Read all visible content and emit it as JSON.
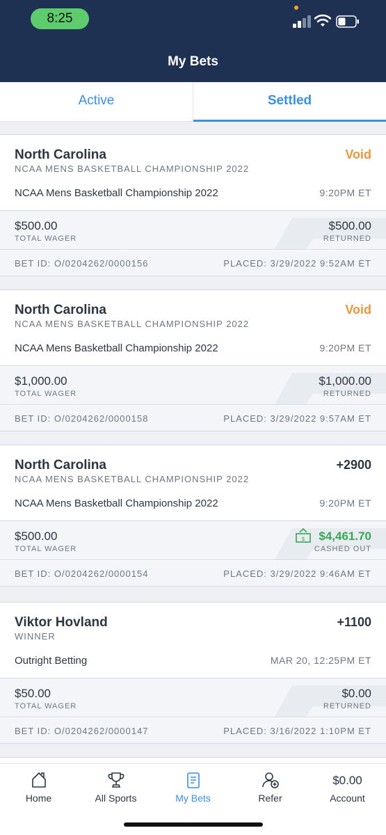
{
  "status_bar": {
    "time": "8:25"
  },
  "header": {
    "title": "My Bets"
  },
  "tabs": [
    {
      "label": "Active"
    },
    {
      "label": "Settled"
    }
  ],
  "bets": [
    {
      "selection": "North Carolina",
      "result": "Void",
      "market": "NCAA MENS BASKETBALL CHAMPIONSHIP 2022",
      "event": "NCAA Mens Basketball Championship 2022",
      "time": "9:20PM ET",
      "wager": "$500.00",
      "wager_label": "TOTAL WAGER",
      "returned": "$500.00",
      "returned_label": "RETURNED",
      "bet_id": "BET ID: O/0204262/0000156",
      "placed": "PLACED: 3/29/2022 9:52AM ET"
    },
    {
      "selection": "North Carolina",
      "result": "Void",
      "market": "NCAA MENS BASKETBALL CHAMPIONSHIP 2022",
      "event": "NCAA Mens Basketball Championship 2022",
      "time": "9:20PM ET",
      "wager": "$1,000.00",
      "wager_label": "TOTAL WAGER",
      "returned": "$1,000.00",
      "returned_label": "RETURNED",
      "bet_id": "BET ID: O/0204262/0000158",
      "placed": "PLACED: 3/29/2022 9:57AM ET"
    },
    {
      "selection": "North Carolina",
      "result": "+2900",
      "market": "NCAA MENS BASKETBALL CHAMPIONSHIP 2022",
      "event": "NCAA Mens Basketball Championship 2022",
      "time": "9:20PM ET",
      "wager": "$500.00",
      "wager_label": "TOTAL WAGER",
      "returned": "$4,461.70",
      "returned_label": "CASHED OUT",
      "bet_id": "BET ID: O/0204262/0000154",
      "placed": "PLACED: 3/29/2022 9:46AM ET"
    },
    {
      "selection": "Viktor Hovland",
      "result": "+1100",
      "market": "WINNER",
      "event": "Outright Betting",
      "time": "MAR 20, 12:25PM ET",
      "wager": "$50.00",
      "wager_label": "TOTAL WAGER",
      "returned": "$0.00",
      "returned_label": "RETURNED",
      "bet_id": "BET ID: O/0204262/0000147",
      "placed": "PLACED: 3/16/2022 1:10PM ET"
    }
  ],
  "bottom_nav": {
    "home": "Home",
    "all_sports": "All Sports",
    "my_bets": "My Bets",
    "refer": "Refer",
    "account_balance": "$0.00",
    "account": "Account"
  },
  "colors": {
    "header_bg": "#1e3152",
    "accent_blue": "#3a8ee6",
    "void_orange": "#e9963f",
    "cashout_green": "#35a852"
  }
}
